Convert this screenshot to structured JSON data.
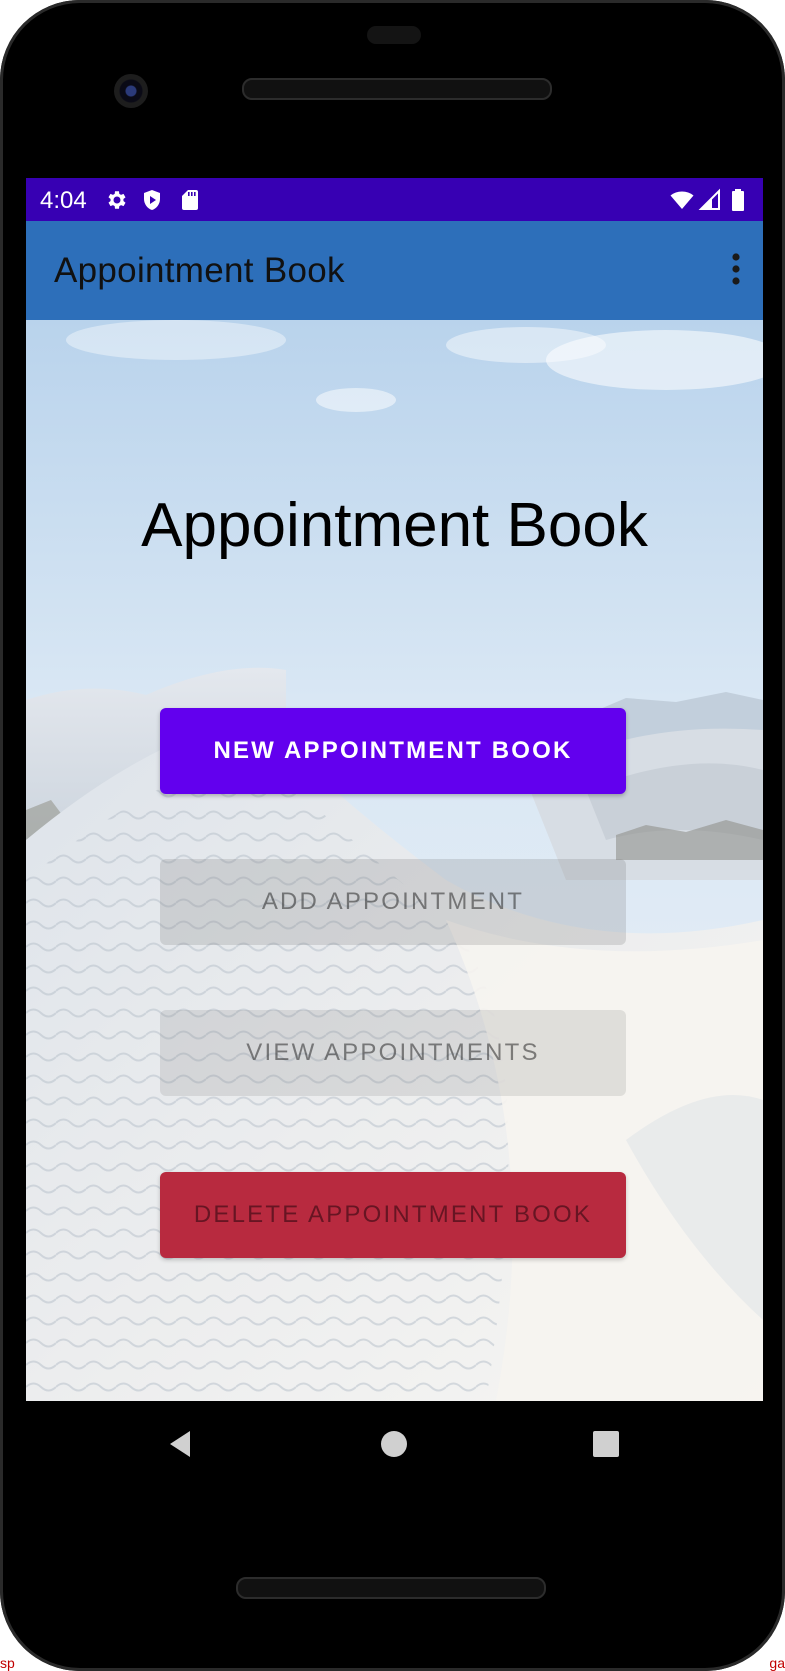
{
  "status_bar": {
    "time": "4:04",
    "left_icons": [
      "gear-icon",
      "shield-play-icon",
      "sd-card-icon"
    ],
    "right_icons": [
      "wifi-icon",
      "signal-icon",
      "battery-icon"
    ]
  },
  "app_bar": {
    "title": "Appointment Book",
    "menu_icon": "more-vert-icon"
  },
  "main": {
    "title": "Appointment Book",
    "buttons": {
      "new_book": "NEW APPOINTMENT BOOK",
      "add_appointment": "ADD APPOINTMENT",
      "view_appointments": "VIEW APPOINTMENTS",
      "delete_book": "DELETE APPOINTMENT BOOK"
    }
  },
  "nav_bar": {
    "icons": [
      "back-icon",
      "home-icon",
      "recents-icon"
    ]
  },
  "colors": {
    "status_bar": "#3700b3",
    "app_bar": "#2d6fba",
    "primary_button": "#6200ee",
    "delete_button": "#b82a3f"
  },
  "corner_text": {
    "left": "sp",
    "right": "ga"
  }
}
